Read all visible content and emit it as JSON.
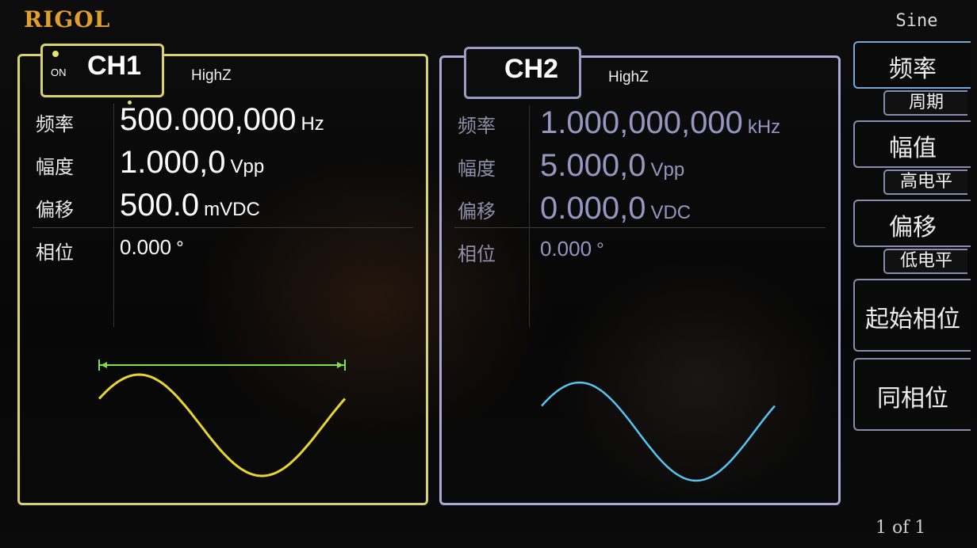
{
  "brand": "RIGOL",
  "waveform": "Sine",
  "page_indicator": "1 of 1",
  "colors": {
    "ch1_accent": "#d9d36a",
    "ch1_trace": "#e8d62c",
    "ch2_accent": "#a9a8d6",
    "ch2_trace": "#57c7f0",
    "ch1_period_marker": "#7ee04a"
  },
  "ch1": {
    "name": "CH1",
    "state": "ON",
    "load": "HighZ",
    "frequency": {
      "label": "频率",
      "value": "500.000,000",
      "unit": "Hz"
    },
    "amplitude": {
      "label": "幅度",
      "value": "1.000,0",
      "unit": "Vpp"
    },
    "offset": {
      "label": "偏移",
      "value": "500.0",
      "unit": "mVDC"
    },
    "phase": {
      "label": "相位",
      "value": "0.000",
      "unit": "°"
    }
  },
  "ch2": {
    "name": "CH2",
    "load": "HighZ",
    "frequency": {
      "label": "频率",
      "value": "1.000,000,000",
      "unit": "kHz"
    },
    "amplitude": {
      "label": "幅度",
      "value": "5.000,0",
      "unit": "Vpp"
    },
    "offset": {
      "label": "偏移",
      "value": "0.000,0",
      "unit": "VDC"
    },
    "phase": {
      "label": "相位",
      "value": "0.000",
      "unit": "°"
    }
  },
  "softkeys": [
    {
      "label": "频率",
      "sub": "周期"
    },
    {
      "label": "幅值",
      "sub": "高电平"
    },
    {
      "label": "偏移",
      "sub": "低电平"
    },
    {
      "label": "起始相位"
    },
    {
      "label": "同相位"
    }
  ]
}
